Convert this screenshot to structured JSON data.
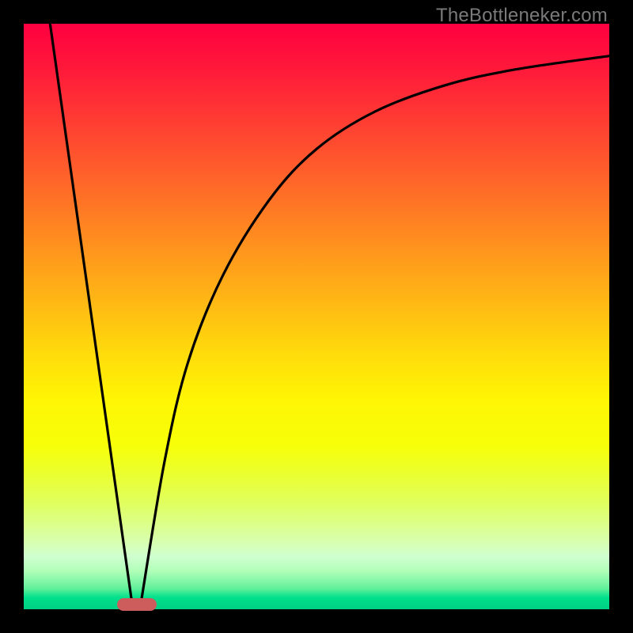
{
  "watermark": "TheBottleneker.com",
  "chart_data": {
    "type": "line",
    "title": "",
    "xlabel": "",
    "ylabel": "",
    "xlim": [
      0,
      100
    ],
    "ylim": [
      0,
      100
    ],
    "legend": false,
    "grid": false,
    "series": [
      {
        "name": "curve",
        "segments": [
          {
            "kind": "line",
            "x": [
              4.5,
              18.5
            ],
            "y": [
              100,
              1
            ]
          },
          {
            "kind": "curve",
            "x": [
              20,
              24,
              28,
              34,
              42,
              50,
              60,
              72,
              84,
              100
            ],
            "y": [
              1,
              25,
              42,
              57,
              70,
              78.6,
              85,
              89.5,
              92.2,
              94.5
            ]
          }
        ]
      }
    ],
    "marker": {
      "x_center": 19.3,
      "x_width_pct": 6.8,
      "y": 0.8,
      "color": "#cd5c5c"
    },
    "gradient_stops": [
      {
        "pct": 0,
        "color": "#ff0040"
      },
      {
        "pct": 50,
        "color": "#ffd000"
      },
      {
        "pct": 80,
        "color": "#f5ff30"
      },
      {
        "pct": 100,
        "color": "#00d084"
      }
    ]
  }
}
